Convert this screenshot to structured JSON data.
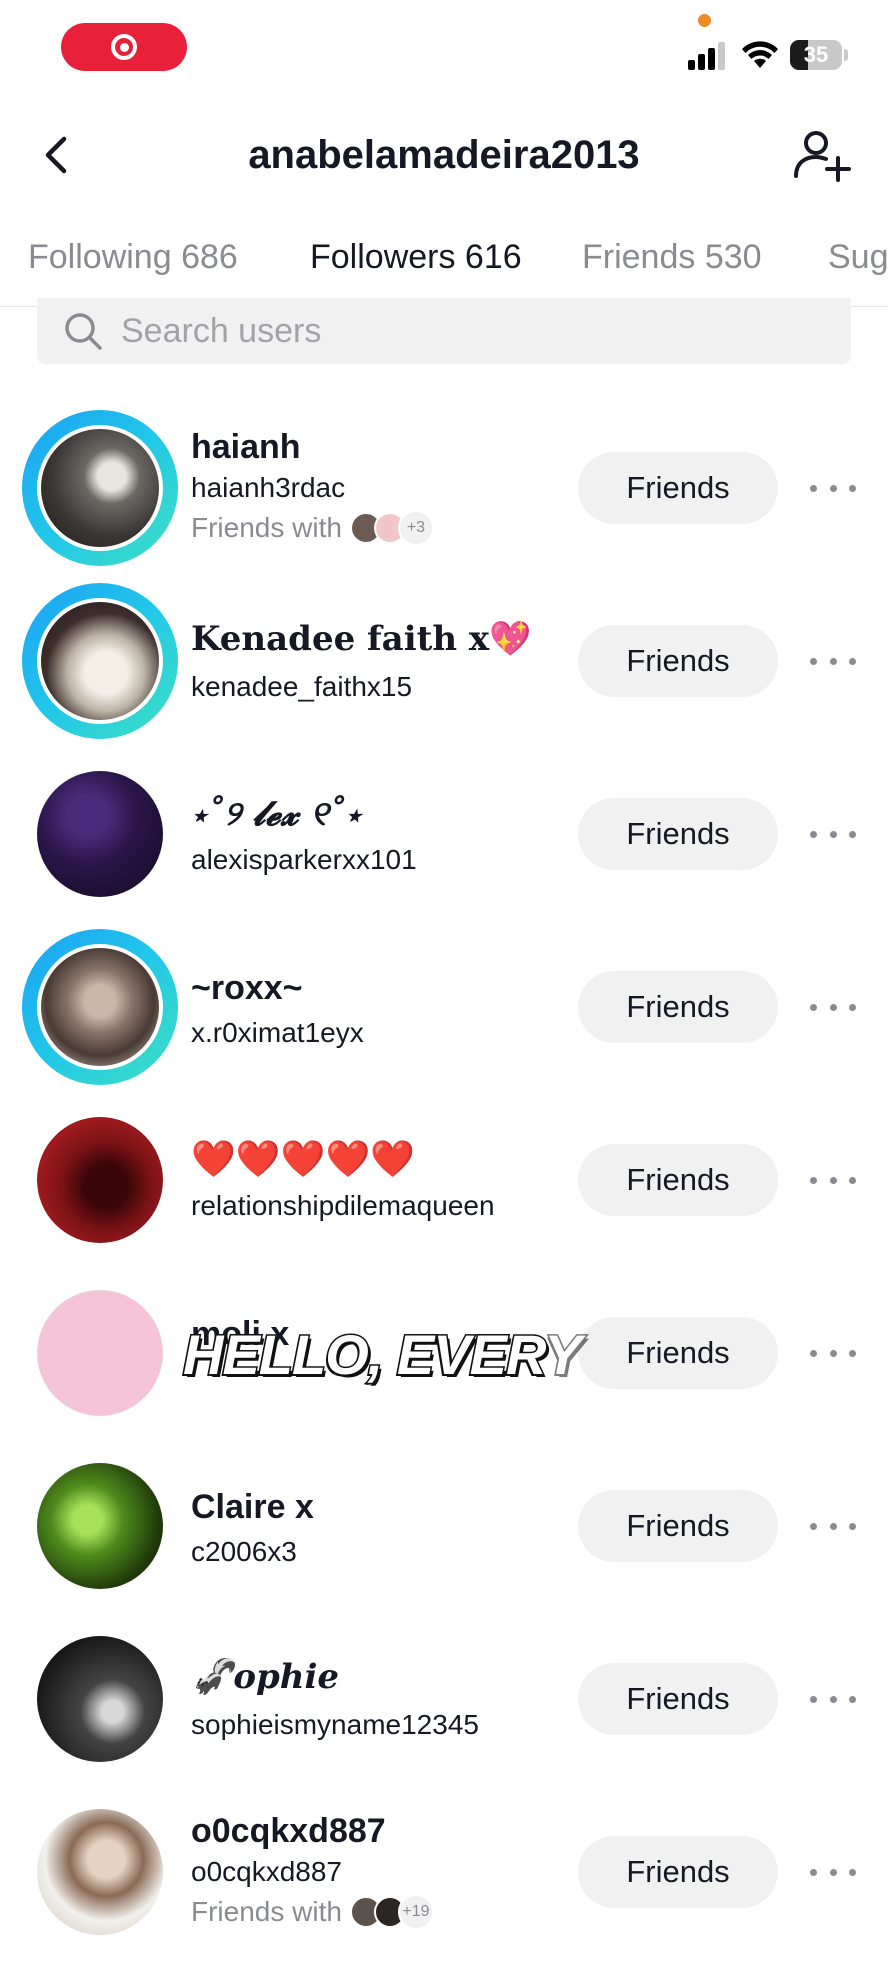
{
  "status_bar": {
    "battery": "35",
    "battery_level": 0.35
  },
  "header": {
    "title": "anabelamadeira2013"
  },
  "tabs": [
    {
      "label": "Following 686"
    },
    {
      "label": "Followers 616"
    },
    {
      "label": "Friends 530"
    },
    {
      "label": "Sug"
    }
  ],
  "active_tab": "Followers 616",
  "search": {
    "placeholder": "Search users",
    "value": ""
  },
  "users": [
    {
      "name": "haianh",
      "username": "haianh3rdac",
      "mutual_text": "Friends with",
      "mutual_extra": "+3",
      "button": "Friends"
    },
    {
      "name": "Kenadee faith x💖",
      "username": "kenadee_faithx15",
      "button": "Friends"
    },
    {
      "name": "⋆˚୨ 𝓵𝓮𝔁 ୧˚⋆",
      "username": "alexisparkerxx101",
      "button": "Friends"
    },
    {
      "name": "~roxx~",
      "username": "x.r0ximat1eyx",
      "button": "Friends"
    },
    {
      "name": "❤️❤️❤️❤️❤️",
      "username": "relationshipdilemaqueen",
      "button": "Friends"
    },
    {
      "name": "moli x",
      "username": "",
      "button": "Friends"
    },
    {
      "name": "Claire x",
      "username": "c2006x3",
      "button": "Friends"
    },
    {
      "name": "🦨ophie",
      "username": "sophieismyname12345",
      "button": "Friends"
    },
    {
      "name": "o0cqkxd887",
      "username": "o0cqkxd887",
      "mutual_text": "Friends with",
      "mutual_extra": "+19",
      "button": "Friends"
    }
  ],
  "caption": {
    "text_main": "HELLO, EVER",
    "text_fade": "Y"
  },
  "colors": {
    "accent_red": "#e8203a",
    "ring_start": "#1aa0f5",
    "ring_end": "#3ee0c0",
    "tab_active": "#161823",
    "muted": "#8a8b91"
  }
}
